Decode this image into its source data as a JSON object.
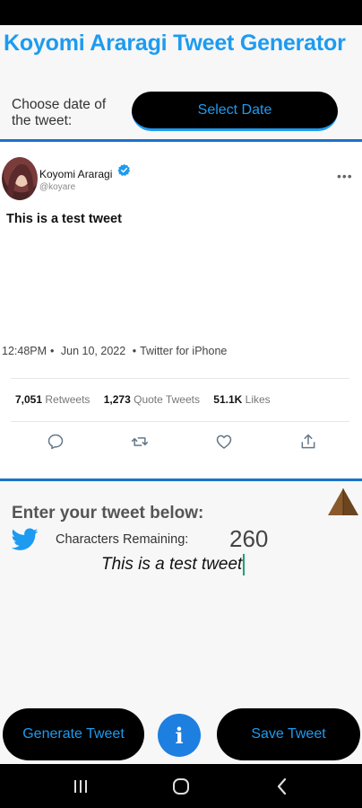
{
  "app": {
    "title": "Koyomi Araragi Tweet Generator"
  },
  "date_picker": {
    "label": "Choose date of the tweet:",
    "button_label": "Select Date"
  },
  "tweet": {
    "display_name": "Koyomi Araragi",
    "handle": "@koyare",
    "text": "This is a test tweet",
    "time": "12:48PM",
    "date": "Jun 10, 2022",
    "source": "Twitter for iPhone",
    "separator": "•",
    "stats": {
      "retweets_count": "7,051",
      "retweets_label": "Retweets",
      "quotes_count": "1,273",
      "quotes_label": "Quote Tweets",
      "likes_count": "51.1K",
      "likes_label": "Likes"
    },
    "actions": [
      "reply-icon",
      "retweet-icon",
      "like-icon",
      "share-icon"
    ]
  },
  "composer": {
    "heading": "Enter your tweet below:",
    "chars_label": "Characters Remaining:",
    "chars_remaining": "260",
    "input_value": "This is a test tweet"
  },
  "footer": {
    "generate_label": "Generate Tweet",
    "info_label": "i",
    "save_label": "Save Tweet"
  },
  "colors": {
    "accent": "#1d9bf0",
    "button_bg": "#000000",
    "divider": "#1a73c9",
    "info_bg": "#1d7fe0"
  }
}
